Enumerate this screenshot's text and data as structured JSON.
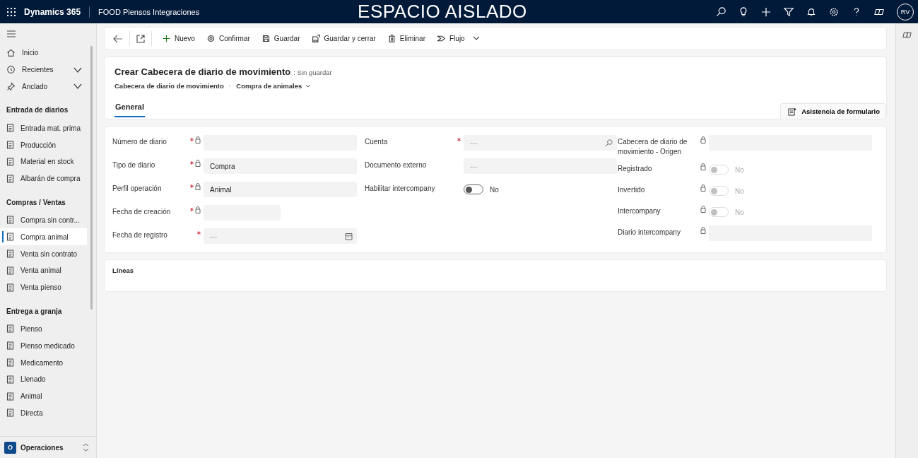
{
  "topbar": {
    "app_name": "Dynamics 365",
    "environment": "FOOD Piensos Integraciones",
    "banner": "ESPACIO AISLADO",
    "avatar": "RV"
  },
  "sidebar": {
    "nav": [
      {
        "label": "Inicio",
        "expandable": false
      },
      {
        "label": "Recientes",
        "expandable": true,
        "expanded": false
      },
      {
        "label": "Anclado",
        "expandable": true,
        "expanded": false
      }
    ],
    "groups": [
      {
        "title": "Entrada de diarios",
        "items": [
          {
            "label": "Entrada mat. prima",
            "selected": false
          },
          {
            "label": "Producción",
            "selected": false
          },
          {
            "label": "Material en stock",
            "selected": false
          },
          {
            "label": "Albarán de compra",
            "selected": false
          }
        ]
      },
      {
        "title": "Compras / Ventas",
        "items": [
          {
            "label": "Compra sin contr...",
            "selected": false
          },
          {
            "label": "Compra animal",
            "selected": true
          },
          {
            "label": "Venta sin contrato",
            "selected": false
          },
          {
            "label": "Venta animal",
            "selected": false
          },
          {
            "label": "Venta pienso",
            "selected": false
          }
        ]
      },
      {
        "title": "Entrega a granja",
        "items": [
          {
            "label": "Pienso",
            "selected": false
          },
          {
            "label": "Pienso medicado",
            "selected": false
          },
          {
            "label": "Medicamento",
            "selected": false
          },
          {
            "label": "Llenado",
            "selected": false
          },
          {
            "label": "Animal",
            "selected": false
          },
          {
            "label": "Directa",
            "selected": false
          }
        ]
      }
    ],
    "area": {
      "badge": "O",
      "label": "Operaciones"
    }
  },
  "command_bar": [
    {
      "label": "Nuevo"
    },
    {
      "label": "Confirmar"
    },
    {
      "label": "Guardar"
    },
    {
      "label": "Guardar y cerrar"
    },
    {
      "label": "Eliminar"
    },
    {
      "label": "Flujo"
    }
  ],
  "header": {
    "title": "Crear Cabecera de diario de movimiento",
    "status": ": Sin guardar",
    "entity": "Cabecera de diario de movimiento",
    "separator": "·",
    "form": "Compra de animales",
    "tabs": [
      {
        "label": "General",
        "selected": true
      }
    ],
    "assist_button": "Asistencia de formulario"
  },
  "form_columns": [
    [
      {
        "kind": "text",
        "label": "Número de diario",
        "required": true,
        "locked": true
      },
      {
        "kind": "text",
        "label": "Tipo de diario",
        "required": true,
        "locked": true,
        "value": "Compra"
      },
      {
        "kind": "text",
        "label": "Perfil operación",
        "required": true,
        "locked": true,
        "value": "Animal"
      },
      {
        "kind": "short",
        "label": "Fecha de creación",
        "required": true,
        "locked": true
      },
      {
        "kind": "date",
        "label": "Fecha de registro",
        "required": true,
        "locked": false,
        "placeholder": "---"
      }
    ],
    [
      {
        "kind": "lookup",
        "label": "Cuenta",
        "required": true,
        "locked": false,
        "placeholder": "---"
      },
      {
        "kind": "text",
        "label": "Documento externo",
        "required": false,
        "locked": false,
        "placeholder": "---"
      },
      {
        "kind": "toggle",
        "label": "Habilitar intercompany",
        "required": false,
        "locked": false,
        "on": false,
        "disabled": false,
        "value": "No"
      }
    ],
    [
      {
        "kind": "text",
        "label": "Cabecera de diario de movimiento - Origen",
        "required": false,
        "locked": true
      },
      {
        "kind": "toggle",
        "label": "Registrado",
        "required": false,
        "locked": true,
        "on": false,
        "disabled": true,
        "value": "No"
      },
      {
        "kind": "toggle",
        "label": "Invertido",
        "required": false,
        "locked": true,
        "on": false,
        "disabled": true,
        "value": "No"
      },
      {
        "kind": "toggle",
        "label": "Intercompany",
        "required": false,
        "locked": true,
        "on": false,
        "disabled": true,
        "value": "No"
      },
      {
        "kind": "text",
        "label": "Diario intercompany",
        "required": false,
        "locked": true
      }
    ]
  ],
  "lines_section": {
    "title": "Líneas"
  }
}
